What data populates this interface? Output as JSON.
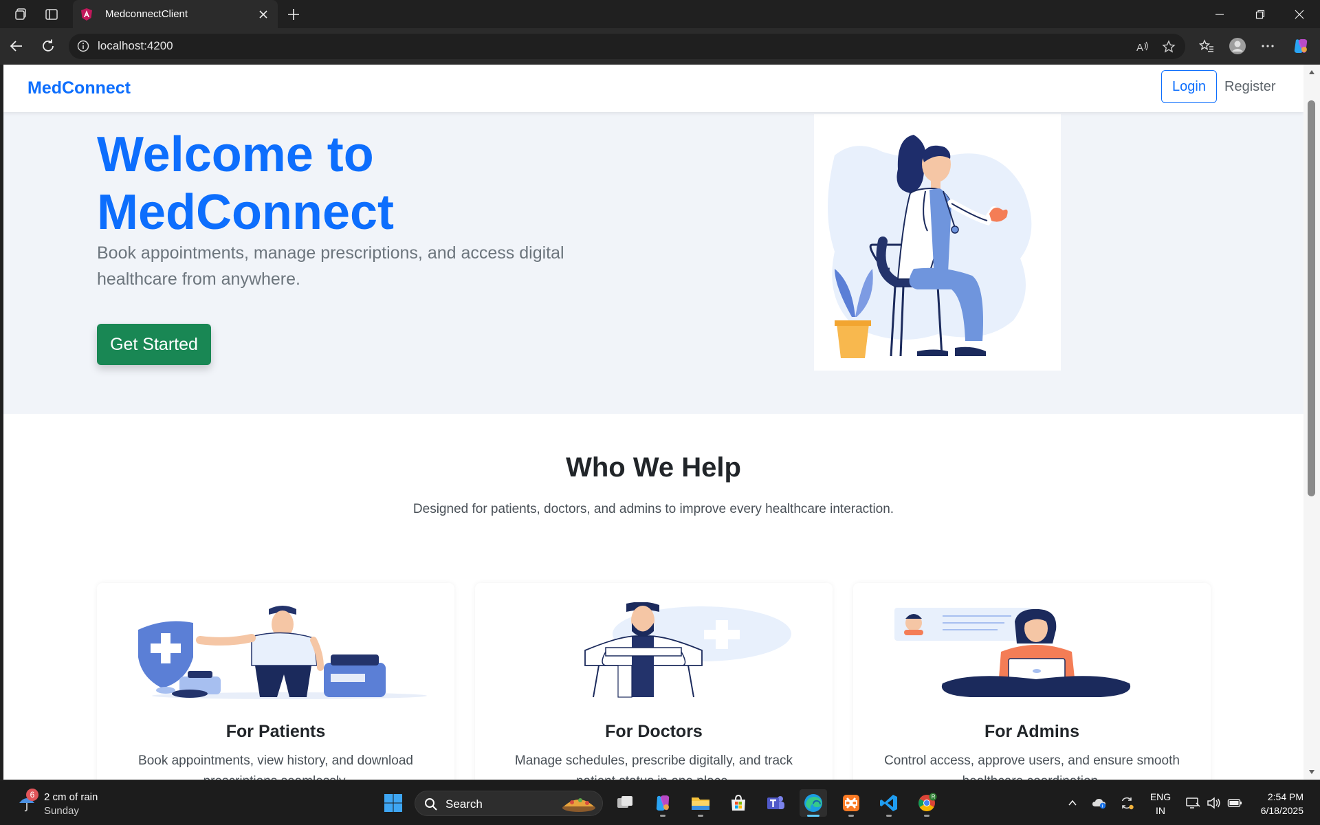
{
  "browser": {
    "tab_title": "MedconnectClient",
    "url": "localhost:4200"
  },
  "navbar": {
    "brand": "MedConnect",
    "login_label": "Login",
    "register_label": "Register"
  },
  "hero": {
    "title_line1": "Welcome to",
    "title_line2": "MedConnect",
    "subtitle": "Book appointments, manage prescriptions, and access digital healthcare from anywhere.",
    "cta_label": "Get Started"
  },
  "who": {
    "title": "Who We Help",
    "subtitle": "Designed for patients, doctors, and admins to improve every healthcare interaction.",
    "cards": [
      {
        "title": "For Patients",
        "text": "Book appointments, view history, and download prescriptions seamlessly."
      },
      {
        "title": "For Doctors",
        "text": "Manage schedules, prescribe digitally, and track patient status in one place."
      },
      {
        "title": "For Admins",
        "text": "Control access, approve users, and ensure smooth healthcare coordination."
      }
    ]
  },
  "taskbar": {
    "weather_badge": "6",
    "weather_line1": "2 cm of rain",
    "weather_line2": "Sunday",
    "search_label": "Search",
    "lang_line1": "ENG",
    "lang_line2": "IN",
    "time": "2:54 PM",
    "date": "6/18/2025"
  },
  "colors": {
    "primary": "#0d6efd",
    "success": "#198754",
    "hero_bg": "#f1f4f9"
  }
}
